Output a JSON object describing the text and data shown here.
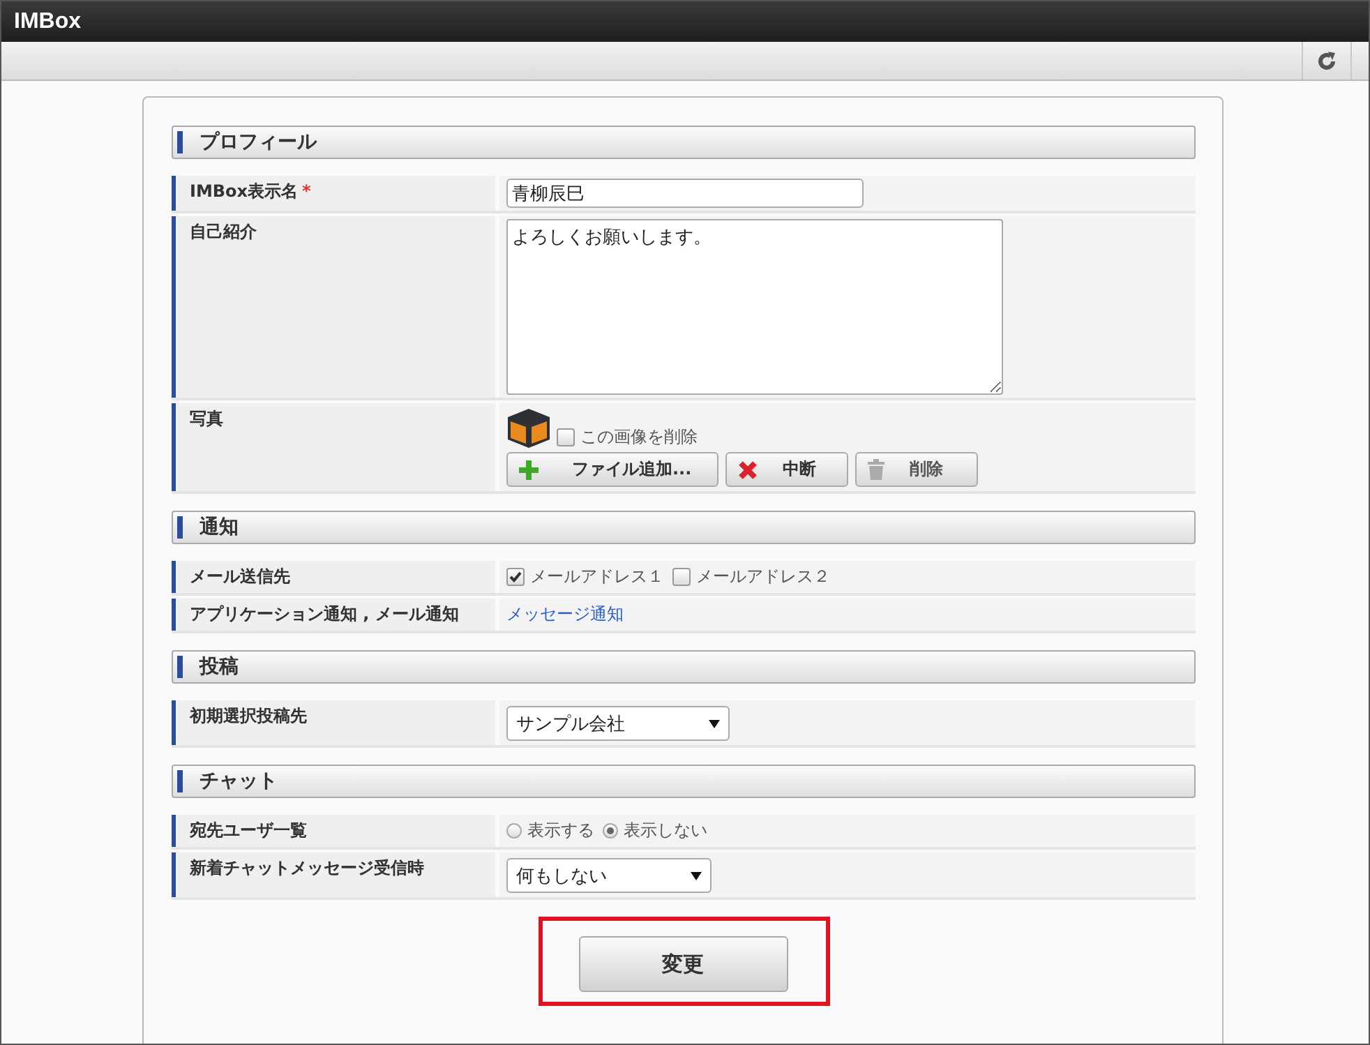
{
  "window": {
    "title": "IMBox"
  },
  "sections": [
    {
      "title": "プロフィール",
      "rows": [
        {
          "label": "IMBox表示名",
          "required_mark": "*",
          "kind": "text",
          "value": "青柳辰巳"
        },
        {
          "label": "自己紹介",
          "kind": "textarea",
          "value": "よろしくお願いします。"
        },
        {
          "label": "写真",
          "kind": "photo",
          "delete_option": {
            "label": "この画像を削除",
            "checked": false
          },
          "buttons": [
            {
              "label": "ファイル追加...",
              "kind": "add",
              "disabled": false
            },
            {
              "label": "中断",
              "kind": "cancel",
              "disabled": false
            },
            {
              "label": "削除",
              "kind": "delete",
              "disabled": true
            }
          ]
        }
      ]
    },
    {
      "title": "通知",
      "rows": [
        {
          "label": "メール送信先",
          "kind": "checkboxes",
          "options": [
            {
              "label": "メールアドレス１",
              "checked": true
            },
            {
              "label": "メールアドレス２",
              "checked": false
            }
          ]
        },
        {
          "label": "アプリケーション通知 , メール通知",
          "kind": "link",
          "value": "メッセージ通知"
        }
      ]
    },
    {
      "title": "投稿",
      "rows": [
        {
          "label": "初期選択投稿先",
          "kind": "select",
          "value": "サンプル会社"
        }
      ]
    },
    {
      "title": "チャット",
      "rows": [
        {
          "label": "宛先ユーザ一覧",
          "kind": "radios",
          "options": [
            {
              "label": "表示する",
              "selected": false
            },
            {
              "label": "表示しない",
              "selected": true
            }
          ]
        },
        {
          "label": "新着チャットメッセージ受信時",
          "kind": "select",
          "value": "何もしない"
        }
      ]
    }
  ],
  "submit": {
    "label": "変更",
    "highlighted": true
  }
}
